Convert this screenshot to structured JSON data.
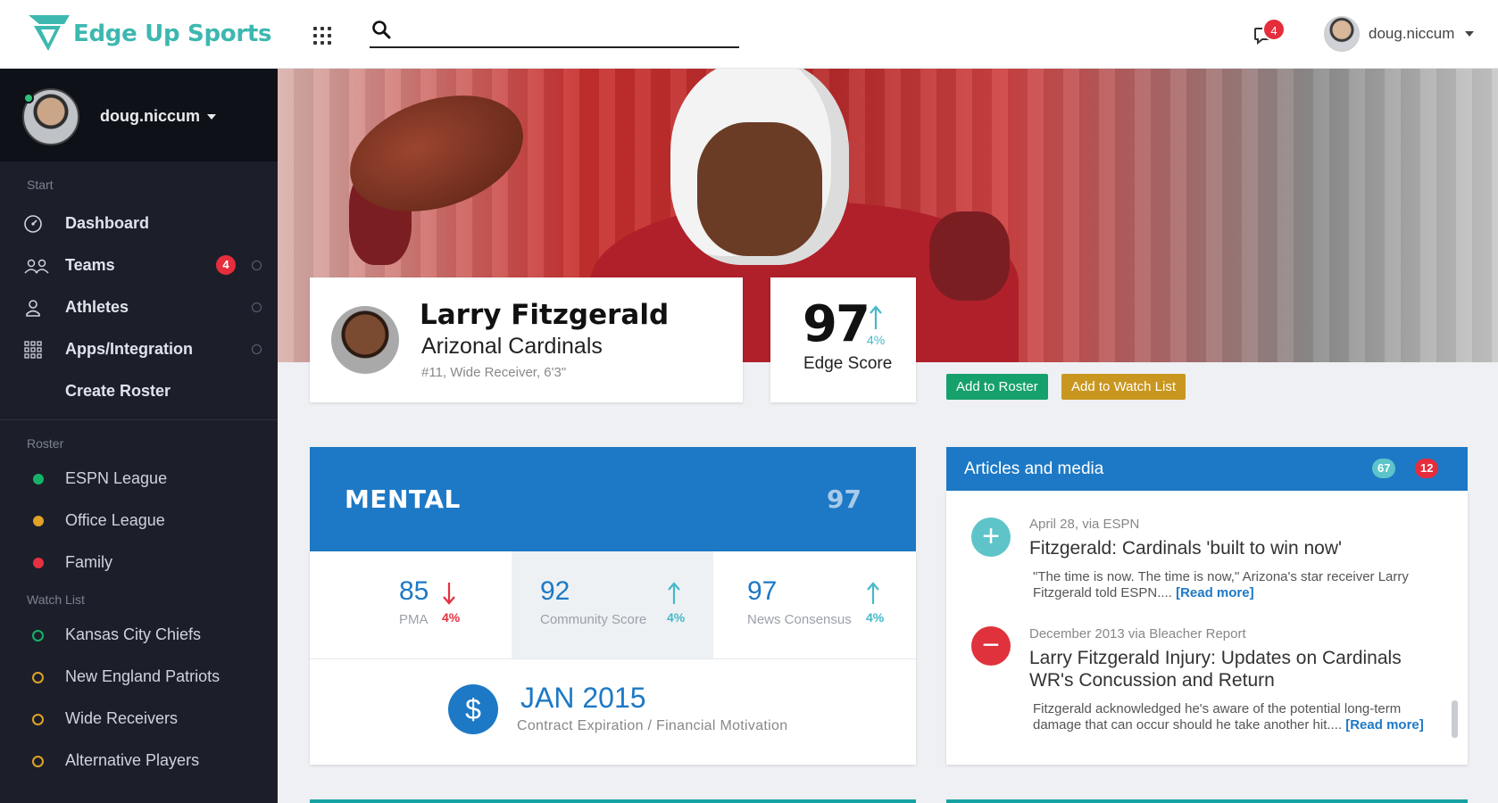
{
  "app": {
    "brand": "Edge Up Sports",
    "search_placeholder": "",
    "notification_count": "4",
    "username": "doug.niccum"
  },
  "sidebar": {
    "username": "doug.niccum",
    "start_label": "Start",
    "nav": [
      {
        "label": "Dashboard",
        "icon": "dashboard-icon"
      },
      {
        "label": "Teams",
        "icon": "teams-icon",
        "badge": "4"
      },
      {
        "label": "Athletes",
        "icon": "athlete-icon"
      },
      {
        "label": "Apps/Integration",
        "icon": "apps-icon"
      },
      {
        "label": "Create Roster"
      }
    ],
    "roster_label": "Roster",
    "roster": [
      {
        "label": "ESPN League",
        "color": "#17b26a"
      },
      {
        "label": "Office League",
        "color": "#e0a227"
      },
      {
        "label": "Family",
        "color": "#e63140"
      }
    ],
    "watch_label": "Watch List",
    "watch": [
      {
        "label": "Kansas City Chiefs",
        "color": "#17b26a"
      },
      {
        "label": "New England Patriots",
        "color": "#e0a227"
      },
      {
        "label": "Wide Receivers",
        "color": "#e0a227"
      },
      {
        "label": "Alternative Players",
        "color": "#e0a227"
      }
    ]
  },
  "player": {
    "name": "Larry Fitzgerald",
    "team": "Arizonal Cardinals",
    "meta": "#11, Wide Receiver, 6'3\"",
    "edge_score": "97",
    "edge_change": "4%",
    "edge_label": "Edge Score"
  },
  "actions": {
    "add_roster": "Add to Roster",
    "add_watch": "Add to Watch List"
  },
  "mental": {
    "title": "MENTAL",
    "score": "97",
    "metrics": [
      {
        "value": "85",
        "label": "PMA",
        "change": "4%",
        "direction": "down"
      },
      {
        "value": "92",
        "label": "Community Score",
        "change": "4%",
        "direction": "up"
      },
      {
        "value": "97",
        "label": "News Consensus",
        "change": "4%",
        "direction": "up"
      }
    ],
    "contract_date": "JAN 2015",
    "contract_desc": "Contract Expiration / Financial Motivation",
    "dollar": "$"
  },
  "articles": {
    "title": "Articles and media",
    "count_a": "67",
    "count_b": "12",
    "items": [
      {
        "source": "April 28, via ESPN",
        "headline": "Fitzgerald: Cardinals 'built to win now'",
        "excerpt": "\"The time is now. The time is now,\" Arizona's star receiver Larry Fitzgerald told ESPN....",
        "read_more": "[Read more]",
        "icon": "+"
      },
      {
        "source": "December 2013 via Bleacher Report",
        "headline": "Larry Fitzgerald Injury: Updates on Cardinals WR's Concussion and Return",
        "excerpt": "Fitzgerald acknowledged he's aware of the potential long-term damage that can occur should he take another hit....",
        "read_more": "[Read more]",
        "icon": "−"
      }
    ]
  }
}
